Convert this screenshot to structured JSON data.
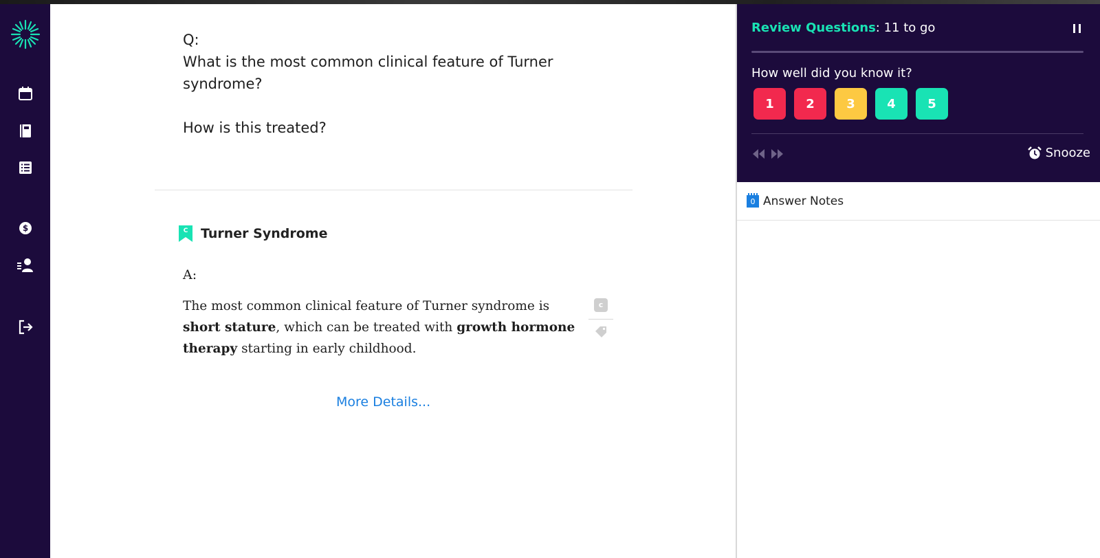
{
  "question": {
    "label": "Q:",
    "text": "What is the most common clinical feature of Turner syndrome?\n\nHow is this treated?"
  },
  "topic": {
    "badge": "C",
    "title": "Turner Syndrome"
  },
  "answer": {
    "label": "A:",
    "parts": {
      "p1": "The most common clinical feature of Turner syndrome is ",
      "b1": "short stature",
      "p2": ", which can be treated with ",
      "b2": "growth hormone therapy",
      "p3": " starting in early childhood."
    },
    "tool_badge": "c",
    "more_details": "More Details..."
  },
  "review": {
    "title_accent": "Review Questions",
    "title_rest": ": 11 to go",
    "prompt": "How well did you know it?",
    "ratings": [
      {
        "label": "1",
        "color": "#f2294e"
      },
      {
        "label": "2",
        "color": "#f2294e"
      },
      {
        "label": "3",
        "color": "#fdc942"
      },
      {
        "label": "4",
        "color": "#19e3b4"
      },
      {
        "label": "5",
        "color": "#19e3b4"
      }
    ],
    "snooze_label": "Snooze"
  },
  "notes": {
    "count": "0",
    "label": "Answer Notes"
  },
  "icons": {
    "nav": [
      "starburst-logo-icon",
      "calendar-icon",
      "notebook-icon",
      "checklist-icon",
      "dollar-icon",
      "user-list-icon",
      "logout-icon"
    ],
    "controls": [
      "pause-icon",
      "rewind-icon",
      "fast-forward-icon",
      "alarm-clock-icon",
      "tag-icon",
      "bookmark-icon"
    ]
  },
  "colors": {
    "nav_bg": "#1c0b3c",
    "accent_teal": "#19e3b4",
    "link_blue": "#1a7fe0"
  }
}
